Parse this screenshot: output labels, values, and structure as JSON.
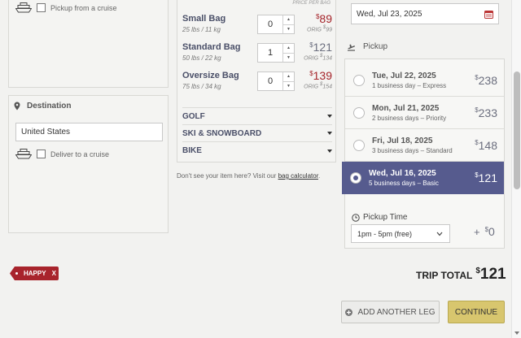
{
  "origin": {
    "pickup_cruise_label": "Pickup from a cruise"
  },
  "destination": {
    "title": "Destination",
    "country_value": "United States",
    "deliver_cruise_label": "Deliver to a cruise"
  },
  "bags": {
    "price_header": "PRICE PER BAG",
    "items": [
      {
        "name": "Small Bag",
        "size": "25 lbs / 11 kg",
        "qty": "0",
        "price": "89",
        "orig": "99"
      },
      {
        "name": "Standard Bag",
        "size": "50 lbs / 22 kg",
        "qty": "1",
        "price": "121",
        "orig": "134"
      },
      {
        "name": "Oversize Bag",
        "size": "75 lbs / 34 kg",
        "qty": "0",
        "price": "139",
        "orig": "154"
      }
    ],
    "orig_prefix": "ORIG",
    "currency": "$",
    "categories": [
      "GOLF",
      "SKI & SNOWBOARD",
      "BIKE"
    ],
    "note_prefix": "Don't see your item here? Visit our ",
    "note_link": "bag calculator",
    "note_suffix": "."
  },
  "date_field": {
    "value": "Wed, Jul 23, 2025"
  },
  "pickup": {
    "title": "Pickup",
    "options": [
      {
        "date": "Tue, Jul 22, 2025",
        "desc": "1 business day – Express",
        "price": "238"
      },
      {
        "date": "Mon, Jul 21, 2025",
        "desc": "2 business days – Priority",
        "price": "233"
      },
      {
        "date": "Fri, Jul 18, 2025",
        "desc": "3 business days – Standard",
        "price": "148"
      },
      {
        "date": "Wed, Jul 16, 2025",
        "desc": "5 business days – Basic",
        "price": "121"
      }
    ],
    "time_title": "Pickup Time",
    "time_value": "1pm - 5pm (free)",
    "time_plus": "+",
    "time_price": "0"
  },
  "promo": {
    "code": "HAPPY",
    "remove": "X"
  },
  "total": {
    "label": "TRIP TOTAL",
    "value": "121"
  },
  "actions": {
    "add_leg": "ADD ANOTHER LEG",
    "continue": "CONTINUE"
  },
  "colors": {
    "selected": "#565b8e",
    "sale_red": "#a5252b",
    "continue_gold": "#d8c66e",
    "promo_red": "#a8242c"
  }
}
